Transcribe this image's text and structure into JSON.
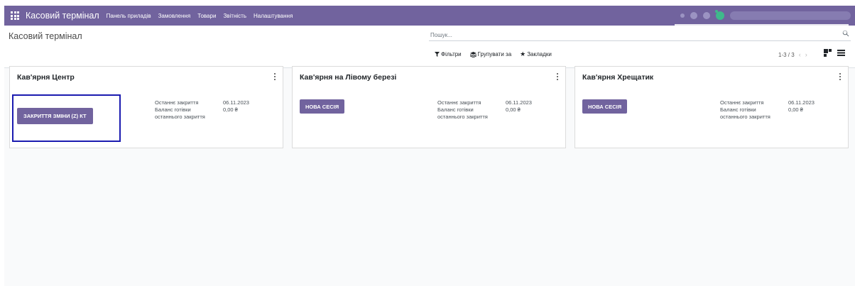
{
  "navbar": {
    "brand": "Касовий термінал",
    "menu": [
      "Панель приладів",
      "Замовлення",
      "Товари",
      "Звітність",
      "Налаштування"
    ]
  },
  "control_panel": {
    "title": "Касовий термінал",
    "search_placeholder": "Пошук...",
    "filters_label": "Фільтри",
    "group_by_label": "Групувати за",
    "favorites_label": "Закладки",
    "pager": "1-3 / 3"
  },
  "cards": [
    {
      "title": "Кав'ярня Центр",
      "button": "ЗАКРИТТЯ ЗМІНИ (Z) КТ",
      "last_closing_label": "Останнє закриття",
      "last_closing_value": "06.11.2023",
      "cash_balance_label": "Баланс готівки останнього закриття",
      "cash_balance_value": "0,00 ₴"
    },
    {
      "title": "Кав'ярня на Лівому березі",
      "button": "НОВА СЕСІЯ",
      "last_closing_label": "Останнє закриття",
      "last_closing_value": "06.11.2023",
      "cash_balance_label": "Баланс готівки останнього закриття",
      "cash_balance_value": "0,00 ₴"
    },
    {
      "title": "Кав'ярня Хрещатик",
      "button": "НОВА СЕСІЯ",
      "last_closing_label": "Останнє закриття",
      "last_closing_value": "06.11.2023",
      "cash_balance_label": "Баланс готівки останнього закриття",
      "cash_balance_value": "0,00 ₴"
    }
  ],
  "colors": {
    "brand": "#71639e",
    "highlight": "#1b1bb0",
    "systray_green": "#3fb98b"
  },
  "icons": [
    "apps-grid-icon",
    "search-icon",
    "filter-icon",
    "layers-icon",
    "star-icon",
    "chevron-left-icon",
    "chevron-right-icon",
    "kanban-view-icon",
    "list-view-icon",
    "kebab-menu-icon"
  ]
}
